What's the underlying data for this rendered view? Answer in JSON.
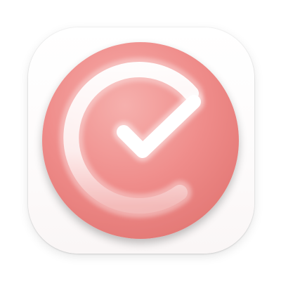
{
  "app_icon": {
    "icon_name": "checkmark-progress-icon",
    "colors": {
      "tile_background": "#fdfbfb",
      "circle": "#ef8c8a",
      "circle_highlight": "#f6b0ad",
      "circle_shadow": "#e27673",
      "ring_and_check": "#ffffff"
    }
  }
}
